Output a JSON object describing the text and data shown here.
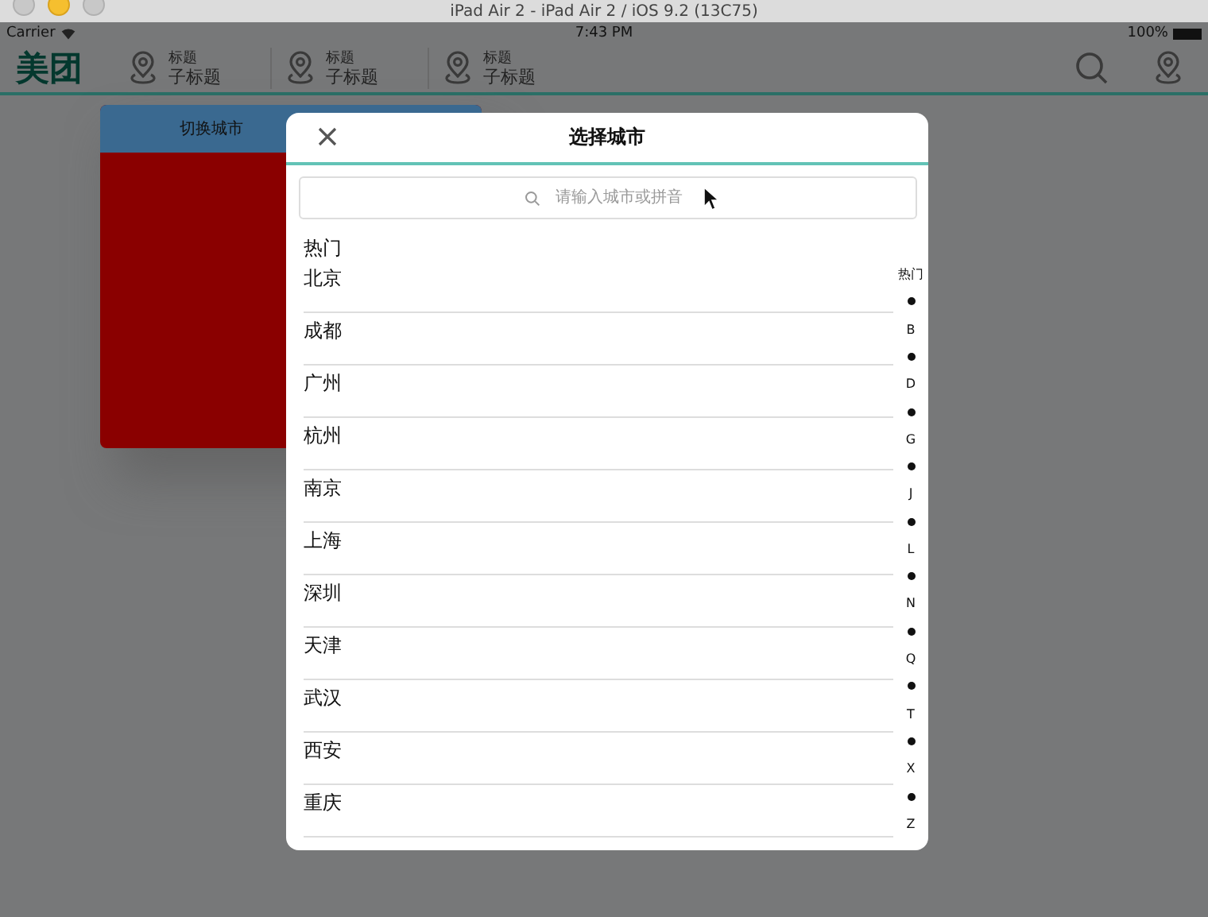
{
  "window": {
    "title": "iPad Air 2 - iPad Air 2 / iOS 9.2 (13C75)"
  },
  "status_bar": {
    "carrier": "Carrier",
    "time": "7:43 PM",
    "battery": "100%"
  },
  "nav": {
    "logo": "美团",
    "tabs": [
      {
        "title": "标题",
        "subtitle": "子标题"
      },
      {
        "title": "标题",
        "subtitle": "子标题"
      },
      {
        "title": "标题",
        "subtitle": "子标题"
      }
    ]
  },
  "background_panel": {
    "title": "切换城市"
  },
  "dialog": {
    "title": "选择城市",
    "search": {
      "placeholder": "请输入城市或拼音"
    },
    "section": "热门",
    "cities": [
      "北京",
      "成都",
      "广州",
      "杭州",
      "南京",
      "上海",
      "深圳",
      "天津",
      "武汉",
      "西安",
      "重庆"
    ],
    "index": [
      {
        "kind": "label",
        "text": "热门"
      },
      {
        "kind": "dot"
      },
      {
        "kind": "label",
        "text": "B"
      },
      {
        "kind": "dot"
      },
      {
        "kind": "label",
        "text": "D"
      },
      {
        "kind": "dot"
      },
      {
        "kind": "label",
        "text": "G"
      },
      {
        "kind": "dot"
      },
      {
        "kind": "label",
        "text": "J"
      },
      {
        "kind": "dot"
      },
      {
        "kind": "label",
        "text": "L"
      },
      {
        "kind": "dot"
      },
      {
        "kind": "label",
        "text": "N"
      },
      {
        "kind": "dot"
      },
      {
        "kind": "label",
        "text": "Q"
      },
      {
        "kind": "dot"
      },
      {
        "kind": "label",
        "text": "T"
      },
      {
        "kind": "dot"
      },
      {
        "kind": "label",
        "text": "X"
      },
      {
        "kind": "dot"
      },
      {
        "kind": "label",
        "text": "Z"
      }
    ]
  }
}
